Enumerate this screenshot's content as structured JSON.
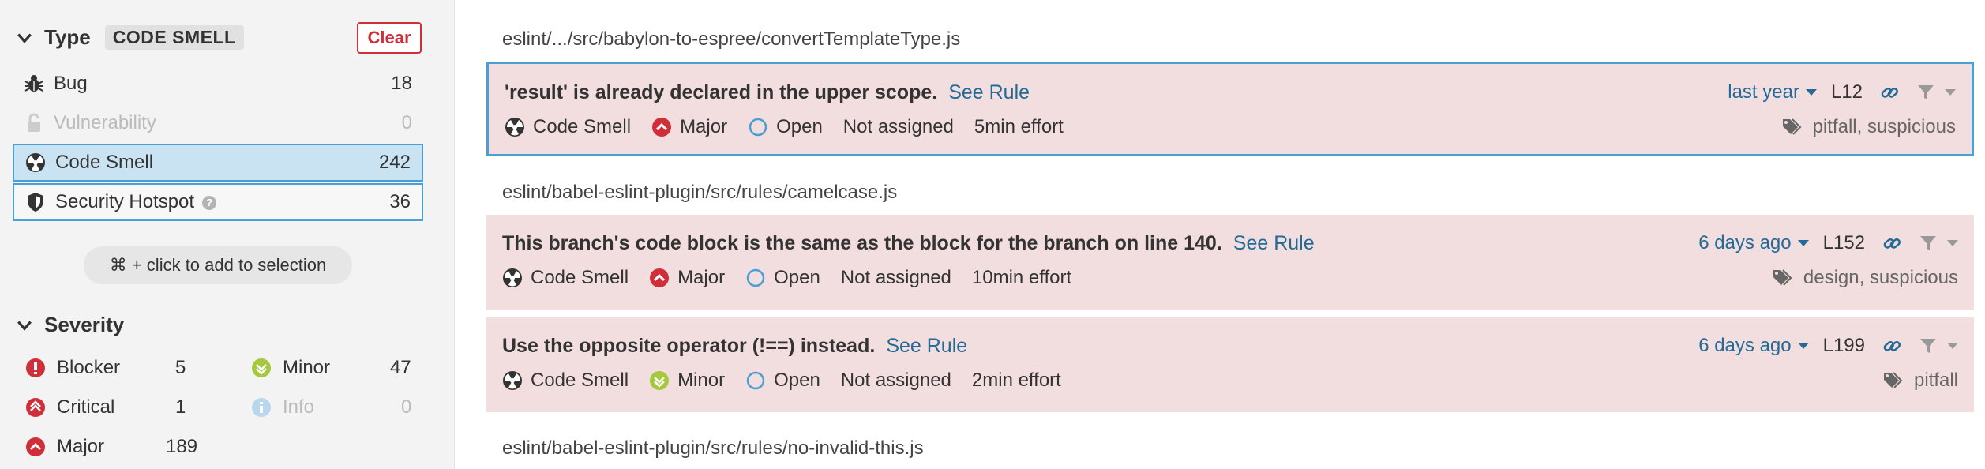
{
  "sidebar": {
    "type_facet": {
      "title": "Type",
      "badge": "CODE SMELL",
      "clear_label": "Clear",
      "items": [
        {
          "label": "Bug",
          "count": "18",
          "icon": "bug-icon"
        },
        {
          "label": "Vulnerability",
          "count": "0",
          "icon": "lock-icon"
        },
        {
          "label": "Code Smell",
          "count": "242",
          "icon": "code-smell-icon"
        },
        {
          "label": "Security Hotspot",
          "count": "36",
          "icon": "shield-icon"
        }
      ],
      "hint": "⌘ + click to add to selection"
    },
    "severity_facet": {
      "title": "Severity",
      "items": [
        {
          "label": "Blocker",
          "count": "5",
          "icon": "blocker-icon"
        },
        {
          "label": "Minor",
          "count": "47",
          "icon": "minor-icon"
        },
        {
          "label": "Critical",
          "count": "1",
          "icon": "critical-icon"
        },
        {
          "label": "Info",
          "count": "0",
          "icon": "info-icon"
        },
        {
          "label": "Major",
          "count": "189",
          "icon": "major-icon"
        }
      ]
    }
  },
  "main": {
    "groups": [
      {
        "file": "eslint/.../src/babylon-to-espree/convertTemplateType.js"
      },
      {
        "file": "eslint/babel-eslint-plugin/src/rules/camelcase.js"
      },
      {
        "file": "eslint/babel-eslint-plugin/src/rules/no-invalid-this.js"
      }
    ],
    "issues": [
      {
        "message": "'result' is already declared in the upper scope.",
        "see_rule": "See Rule",
        "type": "Code Smell",
        "severity": "Major",
        "status": "Open",
        "assignee": "Not assigned",
        "effort": "5min effort",
        "date": "last year",
        "line": "L12",
        "tags": "pitfall, suspicious"
      },
      {
        "message": "This branch's code block is the same as the block for the branch on line 140.",
        "see_rule": "See Rule",
        "type": "Code Smell",
        "severity": "Major",
        "status": "Open",
        "assignee": "Not assigned",
        "effort": "10min effort",
        "date": "6 days ago",
        "line": "L152",
        "tags": "design, suspicious"
      },
      {
        "message": "Use the opposite operator (!==) instead.",
        "see_rule": "See Rule",
        "type": "Code Smell",
        "severity": "Minor",
        "status": "Open",
        "assignee": "Not assigned",
        "effort": "2min effort",
        "date": "6 days ago",
        "line": "L199",
        "tags": "pitfall"
      }
    ]
  },
  "colors": {
    "accent": "#236a97",
    "selected_border": "#4b9fd5",
    "selected_bg": "#cae3f2",
    "issue_bg": "#f2dede",
    "danger": "#d02f3a",
    "minor": "#a5c93c"
  }
}
